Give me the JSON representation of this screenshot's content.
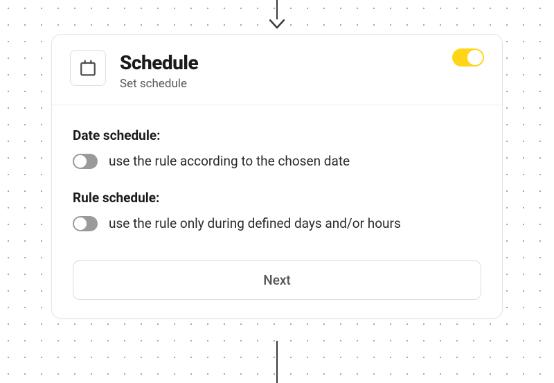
{
  "header": {
    "title": "Schedule",
    "subtitle": "Set schedule",
    "icon": "calendar-icon",
    "main_toggle_on": true
  },
  "sections": {
    "date": {
      "title": "Date schedule:",
      "option_label": "use the rule according to the chosen date",
      "toggle_on": false
    },
    "rule": {
      "title": "Rule schedule:",
      "option_label": "use the rule only during defined days and/or hours",
      "toggle_on": false
    }
  },
  "next_button_label": "Next"
}
